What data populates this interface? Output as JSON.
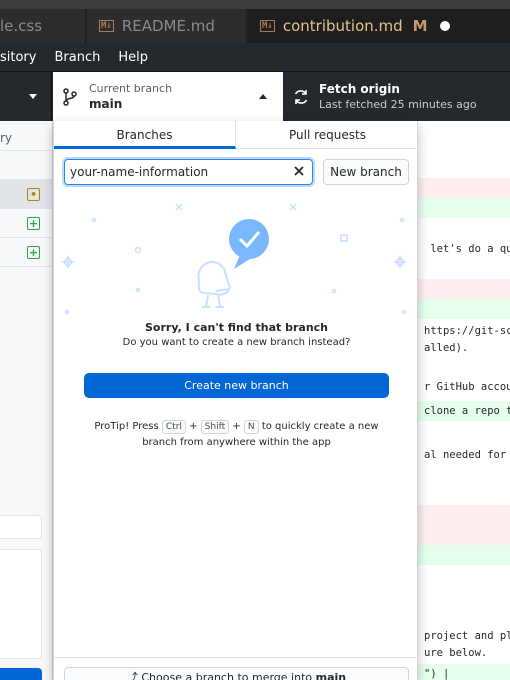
{
  "editor_tabs": [
    {
      "label": "le.css"
    },
    {
      "label": "README.md",
      "icon": "M↓"
    },
    {
      "label": "contribution.md",
      "icon": "M↓",
      "status": "M"
    }
  ],
  "menu": [
    "sitory",
    "Branch",
    "Help"
  ],
  "toolbar": {
    "branch_caption": "Current branch",
    "branch_name": "main",
    "fetch_title": "Fetch origin",
    "fetch_subtitle": "Last fetched 25 minutes ago"
  },
  "sidebar": {
    "header": "ry",
    "file_status": [
      "modified",
      "added",
      "added"
    ]
  },
  "dropdown": {
    "tabs": [
      "Branches",
      "Pull requests"
    ],
    "filter_value": "your-name-information",
    "new_branch_label": "New branch",
    "empty_title": "Sorry, I can't find that branch",
    "empty_subtitle": "Do you want to create a new branch instead?",
    "create_label": "Create new branch",
    "protip": {
      "prefix": "ProTip! Press",
      "key1": "Ctrl",
      "plus": "+",
      "key2": "Shift",
      "key3": "N",
      "suffix1": "to quickly create a new",
      "suffix2": "branch from anywhere within the app"
    },
    "merge_prefix": "Choose a branch to merge into",
    "merge_branch": "main"
  },
  "diff_lines": [
    {
      "text": "",
      "kind": "del"
    },
    {
      "text": "",
      "kind": "add"
    },
    {
      "text": " let's do a qui",
      "kind": "ctx"
    },
    {
      "text": "",
      "kind": "del"
    },
    {
      "text": "",
      "kind": "add"
    },
    {
      "text": "https://git-scm",
      "kind": "ctx"
    },
    {
      "text": "alled).",
      "kind": "ctx"
    },
    {
      "text": "r GitHub account",
      "kind": "ctx"
    },
    {
      "text": "clone a repo th",
      "kind": "add"
    },
    {
      "text": "al needed for t",
      "kind": "ctx"
    },
    {
      "text": "",
      "kind": "del"
    },
    {
      "text": "",
      "kind": "del"
    },
    {
      "text": "",
      "kind": "add"
    },
    {
      "text": "project and pla",
      "kind": "ctx"
    },
    {
      "text": "ure below.",
      "kind": "ctx"
    },
    {
      "text": "\") |",
      "kind": "add"
    }
  ],
  "colors": {
    "accent": "#0366d6",
    "modified": "#b08800",
    "added": "#28a745"
  }
}
